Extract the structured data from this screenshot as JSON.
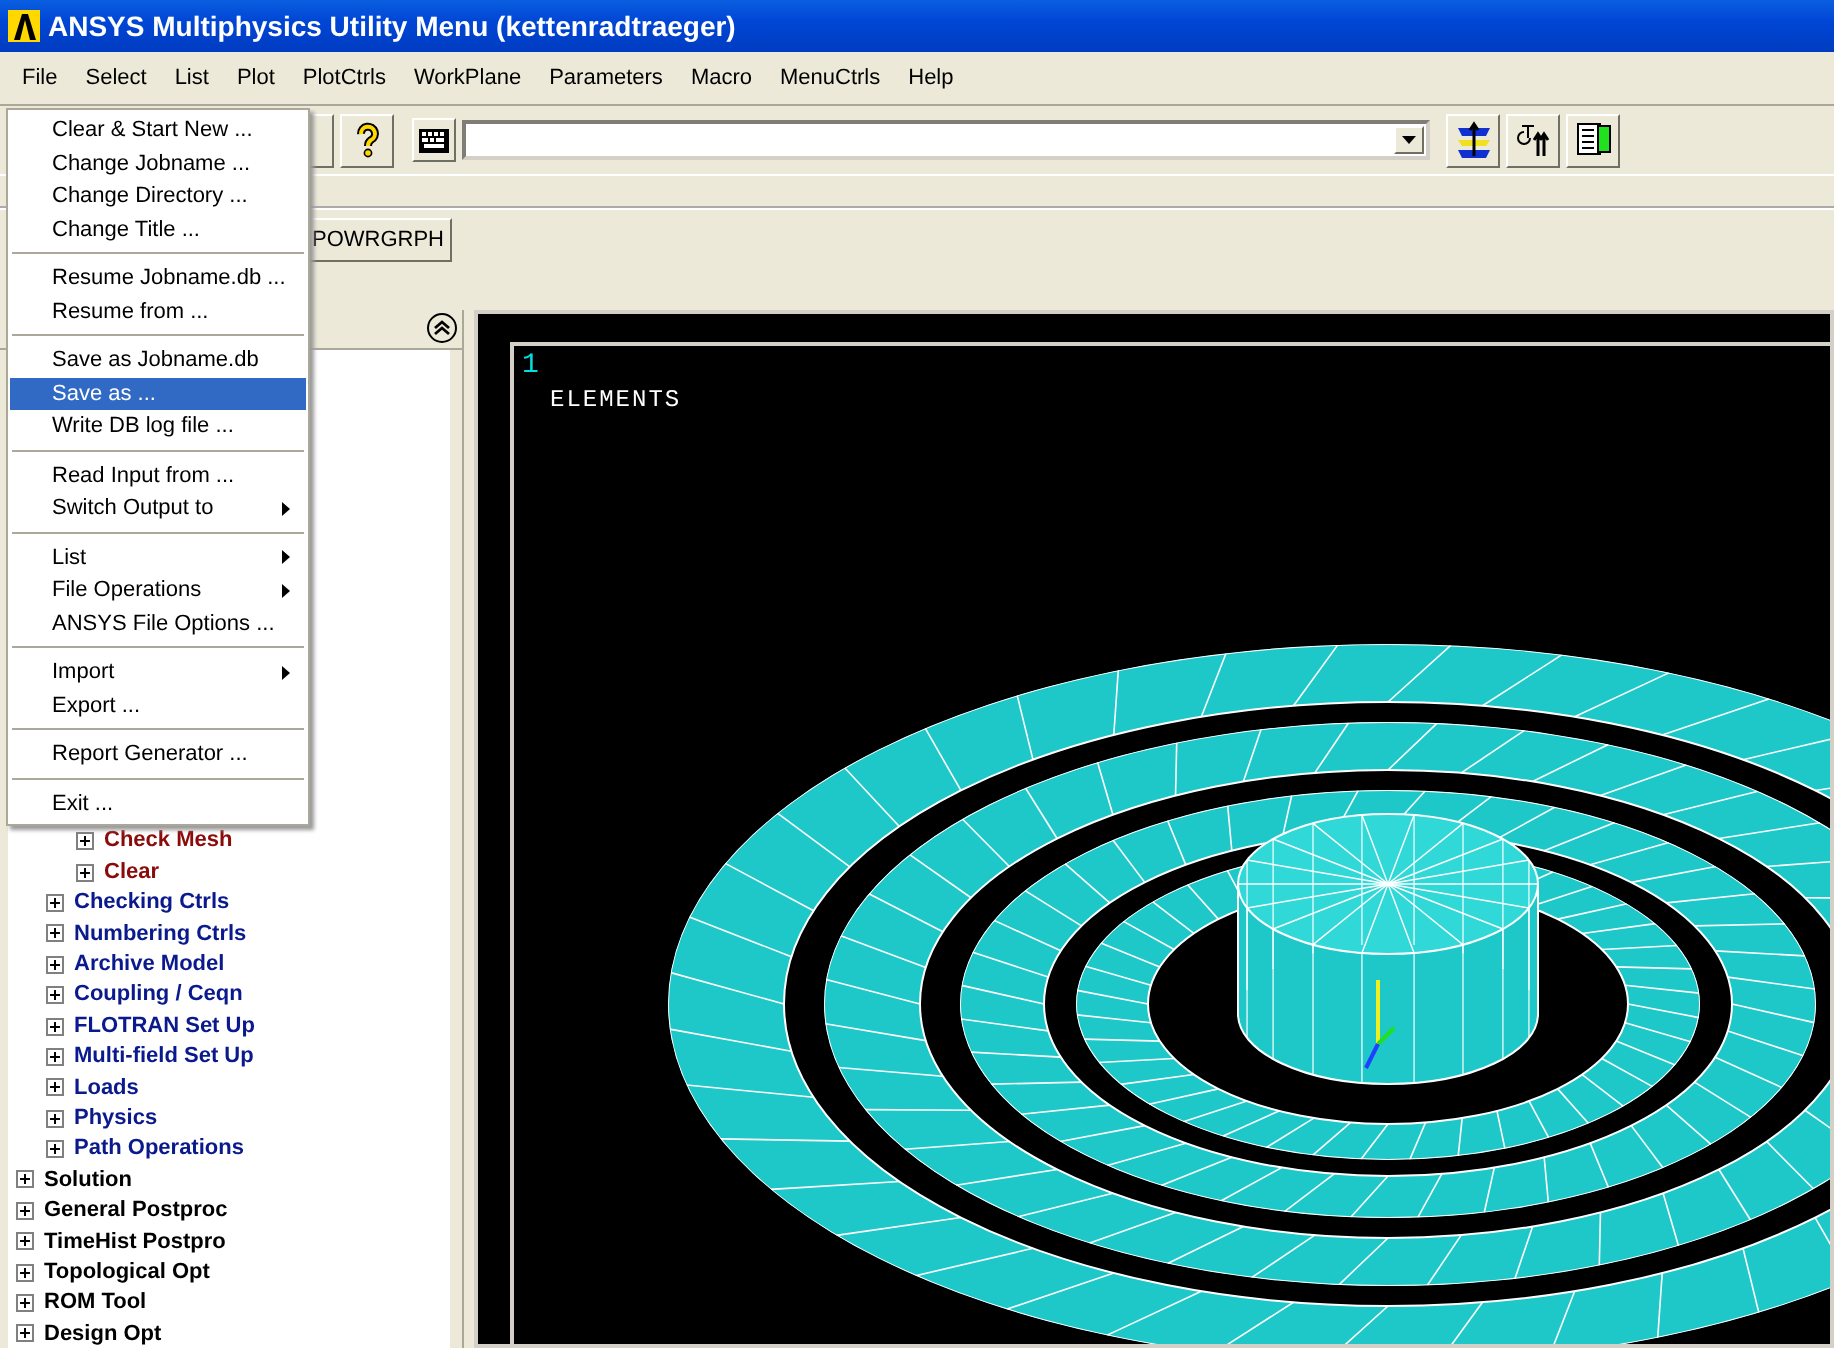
{
  "window": {
    "title": "ANSYS Multiphysics Utility Menu (kettenradtraeger)"
  },
  "menu_bar": [
    "File",
    "Select",
    "List",
    "Plot",
    "PlotCtrls",
    "WorkPlane",
    "Parameters",
    "Macro",
    "MenuCtrls",
    "Help"
  ],
  "file_menu": [
    [
      {
        "label": "Clear & Start New ...",
        "has_submenu": false,
        "selected": false
      },
      {
        "label": "Change Jobname ...",
        "has_submenu": false,
        "selected": false
      },
      {
        "label": "Change Directory ...",
        "has_submenu": false,
        "selected": false
      },
      {
        "label": "Change Title ...",
        "has_submenu": false,
        "selected": false
      }
    ],
    [
      {
        "label": "Resume Jobname.db ...",
        "has_submenu": false,
        "selected": false
      },
      {
        "label": "Resume from ...",
        "has_submenu": false,
        "selected": false
      }
    ],
    [
      {
        "label": "Save as Jobname.db",
        "has_submenu": false,
        "selected": false
      },
      {
        "label": "Save as ...",
        "has_submenu": false,
        "selected": true
      },
      {
        "label": "Write DB log file ...",
        "has_submenu": false,
        "selected": false
      }
    ],
    [
      {
        "label": "Read Input from ...",
        "has_submenu": false,
        "selected": false
      },
      {
        "label": "Switch Output to",
        "has_submenu": true,
        "selected": false
      }
    ],
    [
      {
        "label": "List",
        "has_submenu": true,
        "selected": false
      },
      {
        "label": "File Operations",
        "has_submenu": true,
        "selected": false
      },
      {
        "label": "ANSYS File Options ...",
        "has_submenu": false,
        "selected": false
      }
    ],
    [
      {
        "label": "Import",
        "has_submenu": true,
        "selected": false
      },
      {
        "label": "Export ...",
        "has_submenu": false,
        "selected": false
      }
    ],
    [
      {
        "label": "Report Generator ...",
        "has_submenu": false,
        "selected": false
      }
    ],
    [
      {
        "label": "Exit ...",
        "has_submenu": false,
        "selected": false
      }
    ]
  ],
  "toolbar_buttons": [
    "POWRGRPH"
  ],
  "tree": [
    {
      "children": [
        {
          "children": [
            {
              "label": "Check Mesh",
              "expanded": false
            },
            {
              "label": "Clear",
              "expanded": false
            }
          ]
        },
        {
          "label": "Checking Ctrls",
          "expanded": false
        },
        {
          "label": "Numbering Ctrls",
          "expanded": false
        },
        {
          "label": "Archive Model",
          "expanded": false
        },
        {
          "label": "Coupling / Ceqn",
          "expanded": false
        },
        {
          "label": "FLOTRAN Set Up",
          "expanded": false
        },
        {
          "label": "Multi-field Set Up",
          "expanded": false
        },
        {
          "label": "Loads",
          "expanded": false
        },
        {
          "label": "Physics",
          "expanded": false
        },
        {
          "label": "Path Operations",
          "expanded": false
        }
      ]
    },
    {
      "label": "Solution",
      "expanded": false
    },
    {
      "label": "General Postproc",
      "expanded": false
    },
    {
      "label": "TimeHist Postpro",
      "expanded": false
    },
    {
      "label": "Topological Opt",
      "expanded": false
    },
    {
      "label": "ROM Tool",
      "expanded": false
    },
    {
      "label": "Design Opt",
      "expanded": false
    }
  ],
  "graphics": {
    "window_number": "1",
    "plot_label": "ELEMENTS"
  }
}
